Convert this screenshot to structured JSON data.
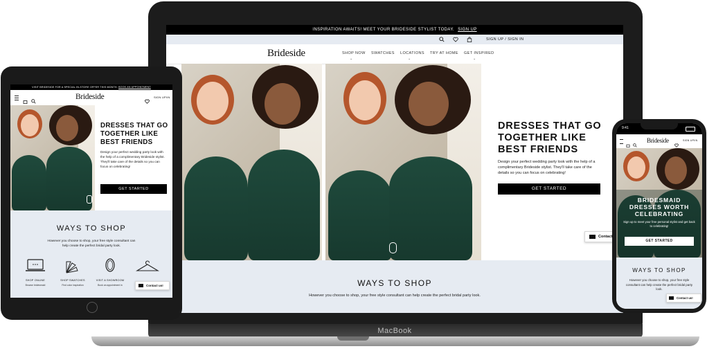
{
  "laptop": {
    "device_label": "MacBook",
    "promo": {
      "text": "INSPIRATION AWAITS! MEET YOUR BRIDESIDE STYLIST TODAY.",
      "link": "SIGN UP"
    },
    "utility": {
      "account": "SIGN UP / SIGN IN"
    },
    "logo": "Brideside",
    "nav": [
      "SHOP NOW",
      "SWATCHES",
      "LOCATIONS",
      "TRY AT HOME",
      "GET INSPIRED"
    ],
    "hero": {
      "heading_lines": [
        "DRESSES THAT GO",
        "TOGETHER LIKE",
        "BEST FRIENDS"
      ],
      "body": "Design your perfect wedding party look with the help of a complimentary Brideside stylist. They'll take care of the details so you can focus on celebrating!",
      "cta": "GET STARTED"
    },
    "ways": {
      "title": "WAYS TO SHOP",
      "subtitle": "However you choose to shop, your free style consultant can help create the perfect bridal party look."
    },
    "contact": "Contact"
  },
  "tablet": {
    "promo": {
      "text": "VISIT BRIDESIDE FOR A SPECIAL IN-STORE OFFER THIS MONTH.",
      "link": "BOOK AN APPOINTMENT"
    },
    "logo": "Brideside",
    "account": "SIGN UP/IN",
    "hero": {
      "heading_lines": [
        "DRESSES THAT GO",
        "TOGETHER LIKE",
        "BEST FRIENDS"
      ],
      "body": "Design your perfect wedding party look with the help of a complimentary Brideside stylist. They'll take care of the details so you can focus on celebrating!",
      "cta": "GET STARTED"
    },
    "ways": {
      "title": "WAYS TO SHOP",
      "subtitle": "However you choose to shop, your free style consultant can help create the perfect bridal party look."
    },
    "shop_options": [
      {
        "icon": "laptop-icon",
        "label": "SHOP ONLINE",
        "desc": "Browse bridesmaid"
      },
      {
        "icon": "swatch-fan-icon",
        "label": "SHOP SWATCHES",
        "desc": "Find color inspiration"
      },
      {
        "icon": "mirror-icon",
        "label": "VISIT A SHOWROOM",
        "desc": "Book an appointment in"
      },
      {
        "icon": "hanger-icon",
        "label": "",
        "desc": ""
      }
    ],
    "contact": "Contact us!"
  },
  "phone": {
    "status_time": "9:41",
    "logo": "Brideside",
    "account": "SIGN UP/IN",
    "hero": {
      "heading_lines": [
        "BRIDESMAID",
        "DRESSES WORTH",
        "CELEBRATING"
      ],
      "body": "Sign up to meet your free personal stylist and get back to celebrating!",
      "cta": "GET STARTED"
    },
    "ways": {
      "title": "WAYS TO SHOP",
      "subtitle": "However you choose to shop, your free style consultant can help create the perfect bridal party look."
    },
    "contact": "Contact us!"
  },
  "colors": {
    "accent_bg": "#e6ebf2",
    "button": "#000000",
    "dress": "#1f4a3c"
  }
}
